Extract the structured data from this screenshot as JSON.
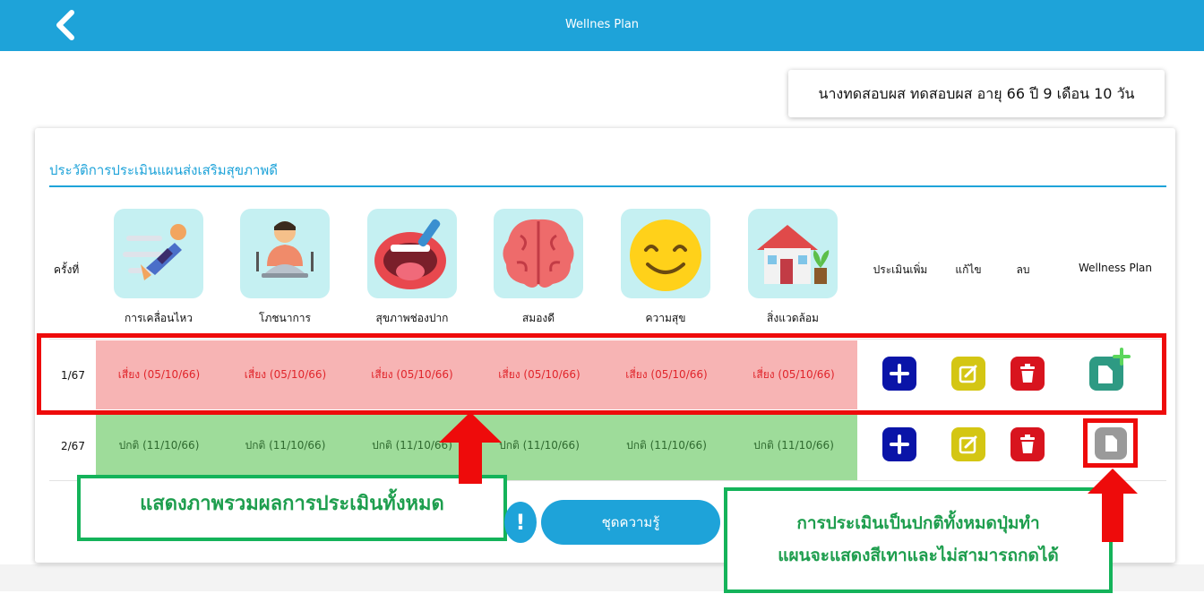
{
  "header": {
    "title": "Wellnes Plan",
    "back_icon": "chevron-left-icon"
  },
  "patient_info": "นางทดสอบผส ทดสอบผส อายุ 66 ปี 9 เดือน 10 วัน",
  "section_title": "ประวัติการประเมินแผนส่งเสริมสุขภาพดี",
  "columns": {
    "round": "ครั้งที่",
    "categories": [
      {
        "label": "การเคลื่อนไหว",
        "icon": "running-person-icon"
      },
      {
        "label": "โภชนาการ",
        "icon": "food-chef-icon"
      },
      {
        "label": "สุขภาพช่องปาก",
        "icon": "mouth-toothbrush-icon"
      },
      {
        "label": "สมองดี",
        "icon": "brain-icon"
      },
      {
        "label": "ความสุข",
        "icon": "smile-face-icon"
      },
      {
        "label": "สิ่งแวดล้อม",
        "icon": "house-plant-icon"
      }
    ],
    "add_assessment": "ประเมินเพิ่ม",
    "edit": "แก้ไข",
    "delete": "ลบ",
    "wellness_plan": "Wellness Plan"
  },
  "rows": [
    {
      "round": "1/67",
      "status": "risk",
      "results": [
        "เสี่ยง (05/10/66)",
        "เสี่ยง (05/10/66)",
        "เสี่ยง (05/10/66)",
        "เสี่ยง (05/10/66)",
        "เสี่ยง (05/10/66)",
        "เสี่ยง (05/10/66)"
      ]
    },
    {
      "round": "2/67",
      "status": "normal",
      "results": [
        "ปกติ (11/10/66)",
        "ปกติ (11/10/66)",
        "ปกติ (11/10/66)",
        "ปกติ (11/10/66)",
        "ปกติ (11/10/66)",
        "ปกติ (11/10/66)"
      ]
    }
  ],
  "footer": {
    "info_mark": "!",
    "knowledge_button": "ชุดความรู้"
  },
  "annotations": {
    "summary": "แสดงภาพรวมผลการประเมินทั้งหมด",
    "gray_note_line1": "การประเมินเป็นปกติทั้งหมดปุ่มทำ",
    "gray_note_line2": "แผนจะแสดงสีเทาและไม่สามารถกดได้"
  },
  "colors": {
    "primary": "#1ea3d9",
    "risk_bg": "#f7b4b4",
    "normal_bg": "#9edc9a",
    "highlight_red": "#ee0b0b",
    "annotation_green": "#14b35a"
  }
}
